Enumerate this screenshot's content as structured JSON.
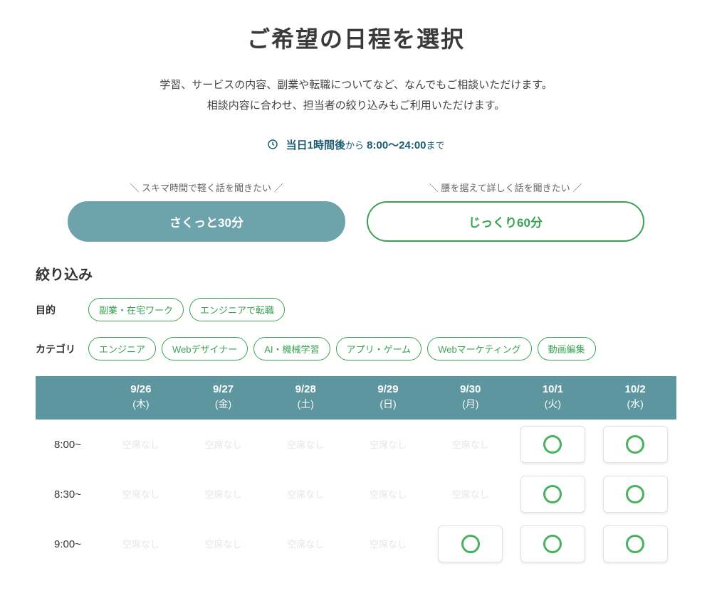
{
  "title": "ご希望の日程を選択",
  "description_line1": "学習、サービスの内容、副業や転職についてなど、なんでもご相談いただけます。",
  "description_line2": "相談内容に合わせ、担当者の絞り込みもご利用いただけます。",
  "hours": {
    "prefix": "当日1時間後",
    "mid": "から",
    "range": "8:00〜24:00",
    "suffix": "まで"
  },
  "duration": {
    "opt1": {
      "tagline": "＼ スキマ時間で軽く話を聞きたい ／",
      "label": "さくっと30分"
    },
    "opt2": {
      "tagline": "＼ 腰を据えて詳しく話を聞きたい ／",
      "label": "じっくり60分"
    }
  },
  "filter": {
    "heading": "絞り込み",
    "purpose_label": "目的",
    "purpose_chips": [
      "副業・在宅ワーク",
      "エンジニアで転職"
    ],
    "category_label": "カテゴリ",
    "category_chips": [
      "エンジニア",
      "Webデザイナー",
      "AI・機械学習",
      "アプリ・ゲーム",
      "Webマーケティング",
      "動画編集"
    ]
  },
  "schedule": {
    "full_label": "空席なし",
    "days": [
      {
        "date": "9/26",
        "dow": "(木)"
      },
      {
        "date": "9/27",
        "dow": "(金)"
      },
      {
        "date": "9/28",
        "dow": "(土)"
      },
      {
        "date": "9/29",
        "dow": "(日)"
      },
      {
        "date": "9/30",
        "dow": "(月)"
      },
      {
        "date": "10/1",
        "dow": "(火)"
      },
      {
        "date": "10/2",
        "dow": "(水)"
      }
    ],
    "rows": [
      {
        "time": "8:00~",
        "slots": [
          "full",
          "full",
          "full",
          "full",
          "full",
          "open",
          "open"
        ]
      },
      {
        "time": "8:30~",
        "slots": [
          "full",
          "full",
          "full",
          "full",
          "full",
          "open",
          "open"
        ]
      },
      {
        "time": "9:00~",
        "slots": [
          "full",
          "full",
          "full",
          "full",
          "open",
          "open",
          "open"
        ]
      }
    ]
  }
}
